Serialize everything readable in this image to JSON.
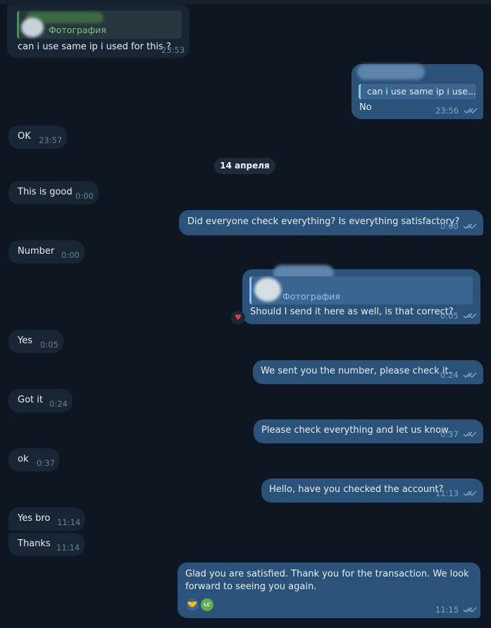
{
  "date_separator": "14 апреля",
  "reply_label": "Фотография",
  "reaction_heart": "♥",
  "reaction_handshake": "🤝",
  "reaction_avatar": "LC",
  "messages": [
    {
      "text": "can i use same ip i used for this ?",
      "time": "23:53"
    },
    {
      "text": "No",
      "reply_text": "can i use same ip i use...",
      "time": "23:56"
    },
    {
      "text": "OK",
      "time": "23:57"
    },
    {
      "text": "This is good",
      "time": "0:00"
    },
    {
      "text": "Did everyone check everything? Is everything satisfactory?",
      "time": "0:00"
    },
    {
      "text": "Number",
      "time": "0:00"
    },
    {
      "text": "Should I send it here as well, is that correct?",
      "time": "0:05"
    },
    {
      "text": "Yes",
      "time": "0:05"
    },
    {
      "text": "We sent you the number, please check it.",
      "time": "0:24"
    },
    {
      "text": "Got it",
      "time": "0:24"
    },
    {
      "text": "Please check everything and let us know.",
      "time": "0:37"
    },
    {
      "text": "ok",
      "time": "0:37"
    },
    {
      "text": "Hello, have you checked the account?",
      "time": "11:13"
    },
    {
      "text": "Yes bro",
      "time": "11:14"
    },
    {
      "text": "Thanks",
      "time": "11:14"
    },
    {
      "text_line1": "Glad you are satisfied. Thank you for the transaction. We look",
      "text_line2": "forward to seeing you again.",
      "time": "11:15"
    }
  ]
}
